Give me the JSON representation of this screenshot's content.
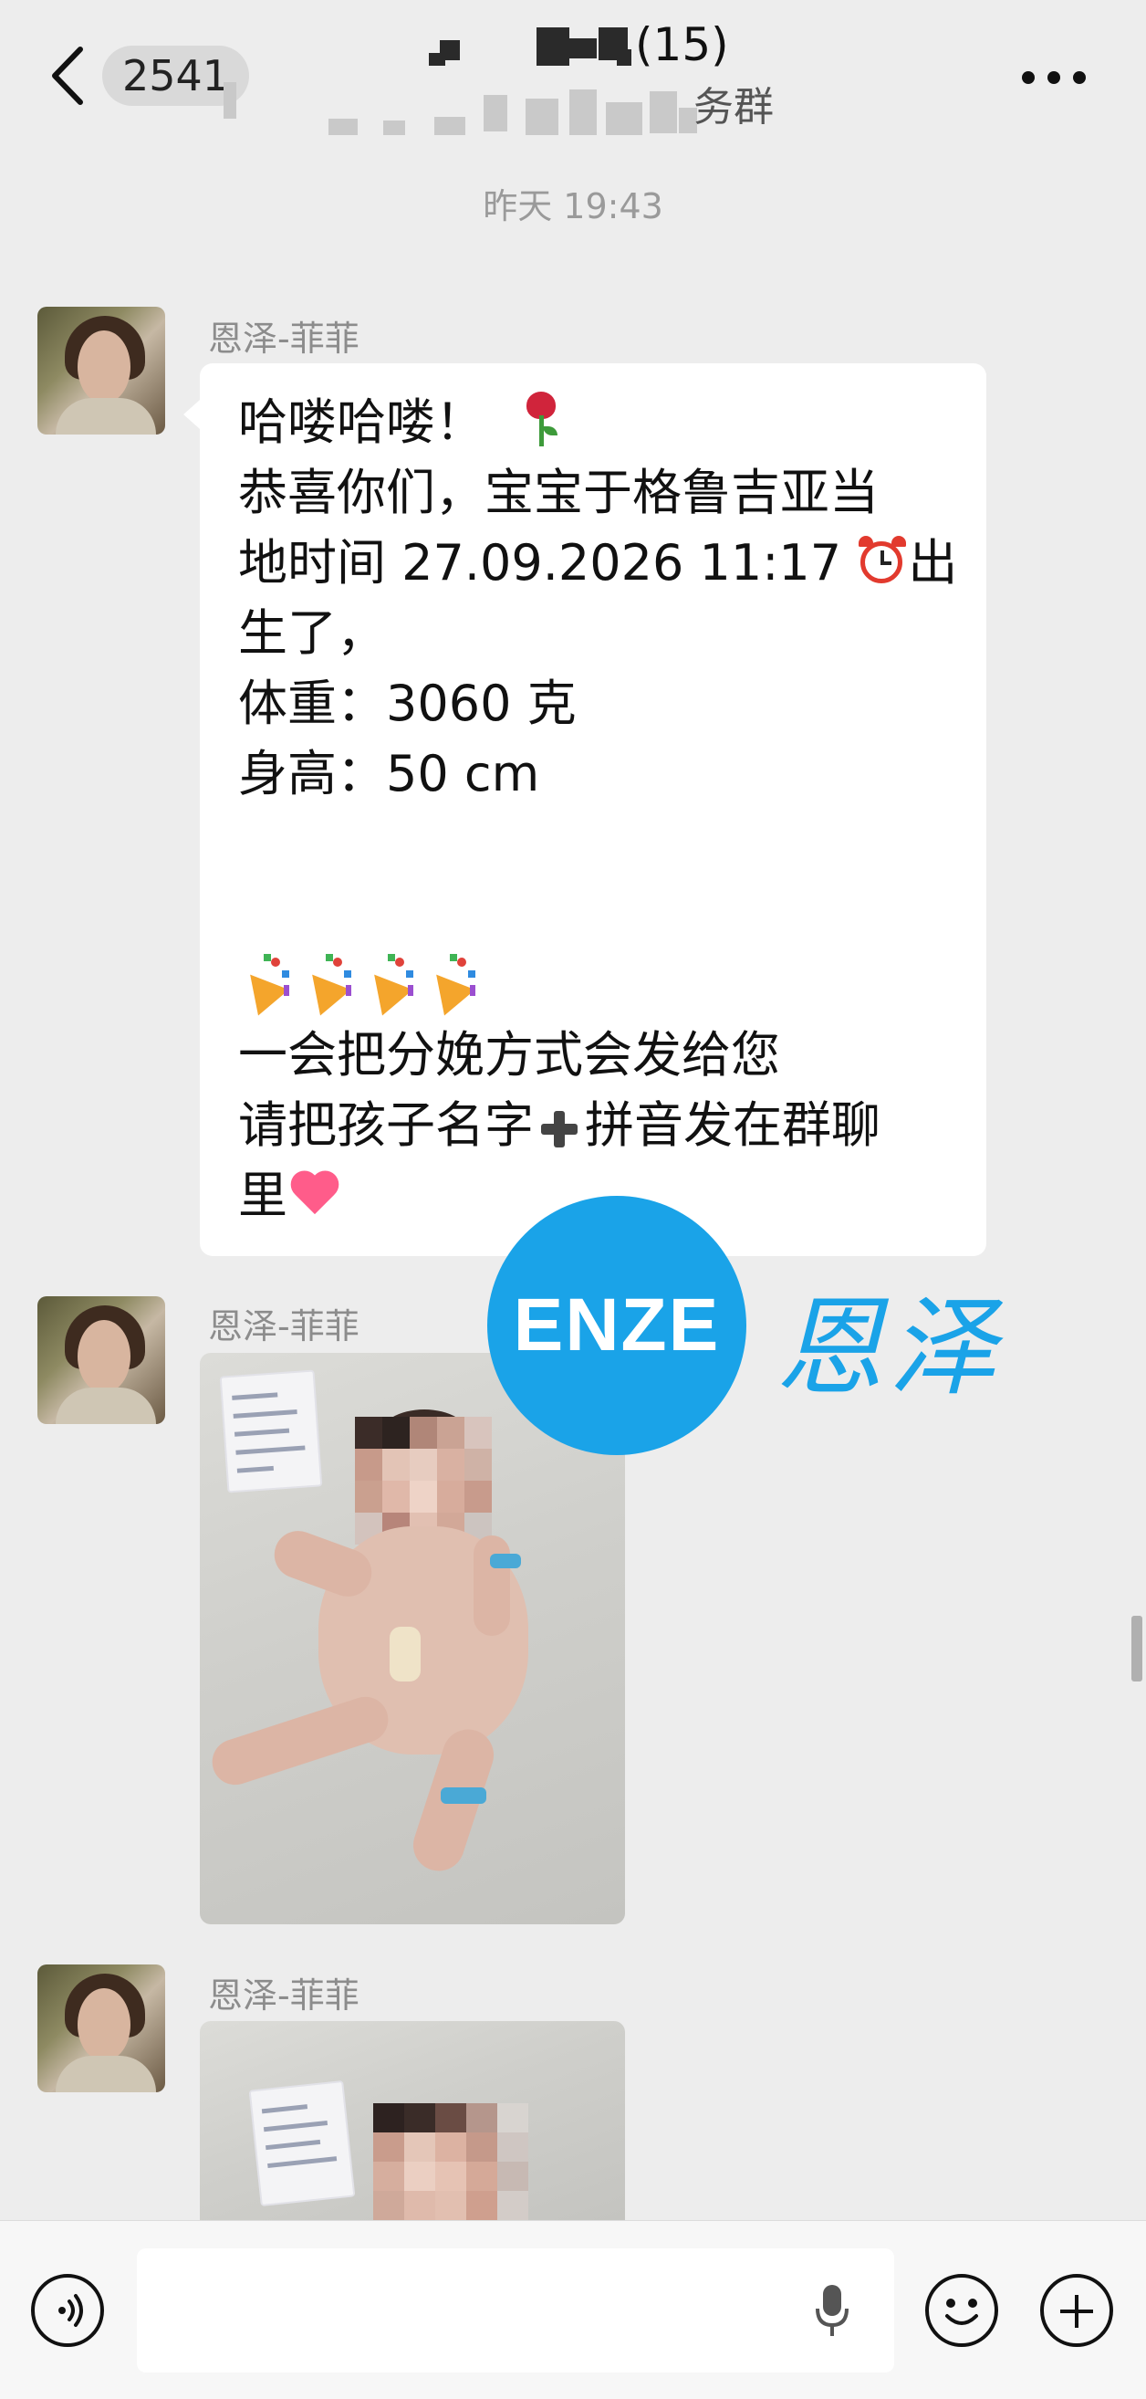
{
  "header": {
    "back_count": "2541",
    "title_count": "(15)",
    "subtitle_visible": "务群"
  },
  "timestamp": "昨天 19:43",
  "messages": [
    {
      "sender": "恩泽-菲菲",
      "lines": [
        "哈喽哈喽！",
        "恭喜你们，宝宝于格鲁吉亚当",
        "地时间 27.09.2026 11:17",
        "出",
        "生了，",
        "体重：3060 克",
        "身高：50 cm",
        "一会把分娩方式会发给您",
        "请把孩子名字",
        "拼音发在群聊",
        "里"
      ]
    },
    {
      "sender": "恩泽-菲菲",
      "type": "image"
    },
    {
      "sender": "恩泽-菲菲",
      "type": "image"
    }
  ],
  "watermark": {
    "logo_text": "ENZE",
    "brand_text": "恩泽",
    "color": "#1aa3e8"
  },
  "colors": {
    "background": "#ededed",
    "bubble": "#ffffff",
    "meta_text": "#8c8c8c"
  },
  "icons": [
    "back-icon",
    "more-icon",
    "voice-icon",
    "mic-icon",
    "emoji-icon",
    "add-icon",
    "rose-emoji",
    "alarm-clock-emoji",
    "party-popper-emoji",
    "plus-emoji",
    "heart-emoji"
  ]
}
